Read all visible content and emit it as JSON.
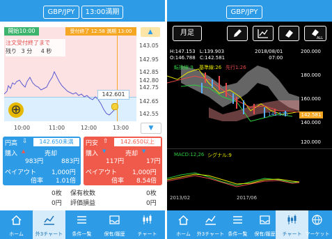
{
  "left": {
    "pair": "GBP/JPY",
    "expiry": "13:00満期",
    "start_tag": "開始10:00",
    "end_tag": "受付終了 12:58 満期 13:00",
    "remaining_line1": "注文受付終了まで",
    "remaining_pre": "残り",
    "remaining_min": "3",
    "remaining_min_unit": "分",
    "remaining_sec": "4",
    "remaining_sec_unit": "秒",
    "price_axis": [
      "143.05",
      "142.95",
      "142.85",
      "142.75",
      "142.65",
      "142.55"
    ],
    "price_axis_extra": "142.80",
    "current_price": "142.601",
    "time_axis": [
      "10:00",
      "11:00",
      "12:00",
      "13:00"
    ],
    "buy_box": {
      "title": "円高",
      "strike": "142.650未満",
      "buy_label": "購入",
      "sell_label": "売却",
      "buy_price": "983円",
      "sell_price": "883円",
      "payout_label": "ペイアウト",
      "payout": "1,000円",
      "rate_label": "倍率",
      "rate": "1.01倍"
    },
    "sell_box": {
      "title": "円安",
      "strike": "142.650以上",
      "buy_label": "購入",
      "sell_label": "売却",
      "buy_price": "117円",
      "sell_price": "17円",
      "payout_label": "ペイアウト",
      "payout": "1,000円",
      "rate_label": "倍率",
      "rate": "8.54倍"
    },
    "summary": {
      "left_count": "0枚",
      "holding_label": "保有枚数",
      "holding_value": "0枚",
      "left_amount": "0円",
      "pl_label": "評価損益",
      "pl_value": "0円"
    }
  },
  "right": {
    "pair": "GBP/JPY",
    "period_button": "月足",
    "ohlc_h": "H:147.153",
    "ohlc_l": "L:139.903",
    "ohlc_o": "O:146.788",
    "ohlc_c": "C:142.581",
    "date": "2018/08/01",
    "time": "07:00",
    "legend1": "転換線:9",
    "legend2": "基準線:26",
    "legend3": "先行1:26",
    "price_axis": [
      "200.000",
      "180.000",
      "160.000",
      "140.000",
      "120.000"
    ],
    "price_tag": "142.581",
    "price_label2": "142.576",
    "macd_label": "MACD:12,26",
    "signal_label": "シグナル:9",
    "x_axis": [
      "2013/02",
      "2017/06"
    ]
  },
  "nav": [
    "ホーム",
    "外3チャート",
    "条件一覧",
    "保有/履歴",
    "チャート",
    "マーケット"
  ],
  "colors": {
    "blue": "#2d9be6",
    "red": "#f05a4a",
    "orange": "#f5a623",
    "chart_pink": "#fde2e4",
    "chart_blue": "#dcefff"
  }
}
